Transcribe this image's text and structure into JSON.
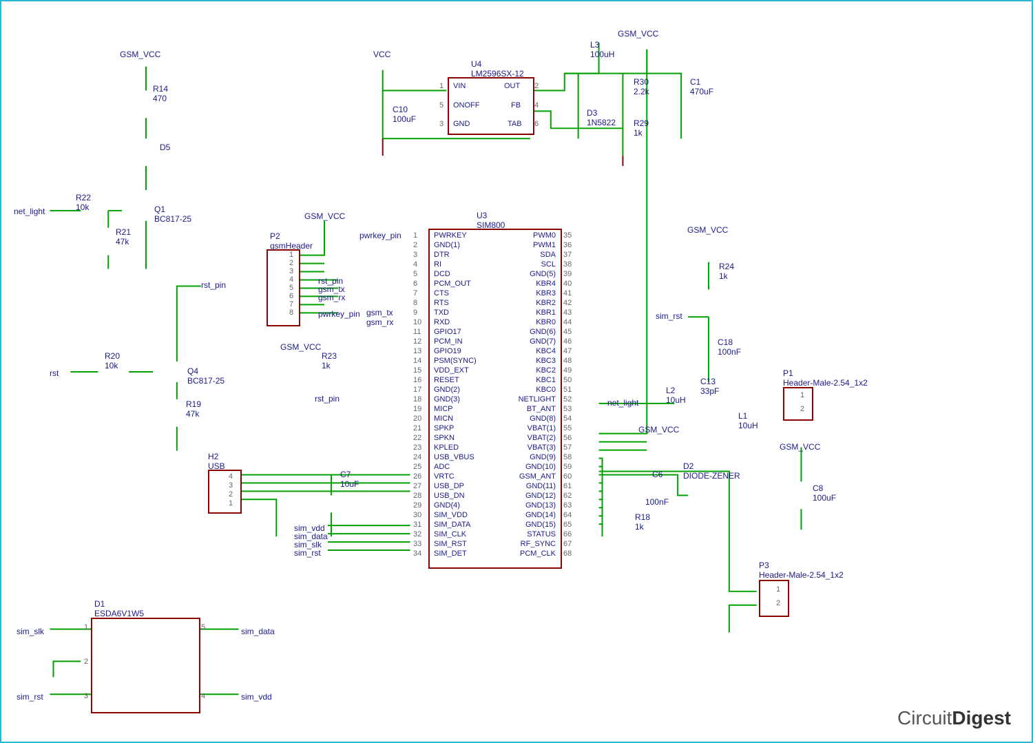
{
  "power_labels": {
    "gsm_vcc": "GSM_VCC",
    "vcc": "VCC"
  },
  "net_labels": {
    "net_light": "net_light",
    "rst_pin": "rst_pin",
    "rst": "rst",
    "pwrkey_pin": "pwrkey_pin",
    "gsm_tx": "gsm_tx",
    "gsm_rx": "gsm_rx",
    "sim_rst": "sim_rst",
    "sim_vdd": "sim_vdd",
    "sim_data": "sim_data",
    "sim_slk": "sim_slk"
  },
  "components": {
    "U3": {
      "ref": "U3",
      "value": "SIM800",
      "left_pins": [
        {
          "num": "1",
          "name": "PWRKEY"
        },
        {
          "num": "2",
          "name": "GND(1)"
        },
        {
          "num": "3",
          "name": "DTR"
        },
        {
          "num": "4",
          "name": "RI"
        },
        {
          "num": "5",
          "name": "DCD"
        },
        {
          "num": "6",
          "name": "PCM_OUT"
        },
        {
          "num": "7",
          "name": "CTS"
        },
        {
          "num": "8",
          "name": "RTS"
        },
        {
          "num": "9",
          "name": "TXD"
        },
        {
          "num": "10",
          "name": "RXD"
        },
        {
          "num": "11",
          "name": "GPIO17"
        },
        {
          "num": "12",
          "name": "PCM_IN"
        },
        {
          "num": "13",
          "name": "GPIO19"
        },
        {
          "num": "14",
          "name": "PSM(SYNC)"
        },
        {
          "num": "15",
          "name": "VDD_EXT"
        },
        {
          "num": "16",
          "name": "RESET"
        },
        {
          "num": "17",
          "name": "GND(2)"
        },
        {
          "num": "18",
          "name": "GND(3)"
        },
        {
          "num": "19",
          "name": "MICP"
        },
        {
          "num": "20",
          "name": "MICN"
        },
        {
          "num": "21",
          "name": "SPKP"
        },
        {
          "num": "22",
          "name": "SPKN"
        },
        {
          "num": "23",
          "name": "KPLED"
        },
        {
          "num": "24",
          "name": "USB_VBUS"
        },
        {
          "num": "25",
          "name": "ADC"
        },
        {
          "num": "26",
          "name": "VRTC"
        },
        {
          "num": "27",
          "name": "USB_DP"
        },
        {
          "num": "28",
          "name": "USB_DN"
        },
        {
          "num": "29",
          "name": "GND(4)"
        },
        {
          "num": "30",
          "name": "SIM_VDD"
        },
        {
          "num": "31",
          "name": "SIM_DATA"
        },
        {
          "num": "32",
          "name": "SIM_CLK"
        },
        {
          "num": "33",
          "name": "SIM_RST"
        },
        {
          "num": "34",
          "name": "SIM_DET"
        }
      ],
      "right_pins": [
        {
          "num": "35",
          "name": "PWM0"
        },
        {
          "num": "36",
          "name": "PWM1"
        },
        {
          "num": "37",
          "name": "SDA"
        },
        {
          "num": "38",
          "name": "SCL"
        },
        {
          "num": "39",
          "name": "GND(5)"
        },
        {
          "num": "40",
          "name": "KBR4"
        },
        {
          "num": "41",
          "name": "KBR3"
        },
        {
          "num": "42",
          "name": "KBR2"
        },
        {
          "num": "43",
          "name": "KBR1"
        },
        {
          "num": "44",
          "name": "KBR0"
        },
        {
          "num": "45",
          "name": "GND(6)"
        },
        {
          "num": "46",
          "name": "GND(7)"
        },
        {
          "num": "47",
          "name": "KBC4"
        },
        {
          "num": "48",
          "name": "KBC3"
        },
        {
          "num": "49",
          "name": "KBC2"
        },
        {
          "num": "50",
          "name": "KBC1"
        },
        {
          "num": "51",
          "name": "KBC0"
        },
        {
          "num": "52",
          "name": "NETLIGHT"
        },
        {
          "num": "53",
          "name": "BT_ANT"
        },
        {
          "num": "54",
          "name": "GND(8)"
        },
        {
          "num": "55",
          "name": "VBAT(1)"
        },
        {
          "num": "56",
          "name": "VBAT(2)"
        },
        {
          "num": "57",
          "name": "VBAT(3)"
        },
        {
          "num": "58",
          "name": "GND(9)"
        },
        {
          "num": "59",
          "name": "GND(10)"
        },
        {
          "num": "60",
          "name": "GSM_ANT"
        },
        {
          "num": "61",
          "name": "GND(11)"
        },
        {
          "num": "62",
          "name": "GND(12)"
        },
        {
          "num": "63",
          "name": "GND(13)"
        },
        {
          "num": "64",
          "name": "GND(14)"
        },
        {
          "num": "65",
          "name": "GND(15)"
        },
        {
          "num": "66",
          "name": "STATUS"
        },
        {
          "num": "67",
          "name": "RF_SYNC"
        },
        {
          "num": "68",
          "name": "PCM_CLK"
        }
      ]
    },
    "U4": {
      "ref": "U4",
      "value": "LM2596SX-12",
      "pins": [
        {
          "num": "1",
          "name": "VIN"
        },
        {
          "num": "2",
          "name": "OUT"
        },
        {
          "num": "5",
          "name": "ONOFF"
        },
        {
          "num": "4",
          "name": "FB"
        },
        {
          "num": "3",
          "name": "GND"
        },
        {
          "num": "6",
          "name": "TAB"
        }
      ]
    },
    "P1": {
      "ref": "P1",
      "value": "Header-Male-2.54_1x2",
      "pins": [
        "1",
        "2"
      ]
    },
    "P2": {
      "ref": "P2",
      "value": "gsmHeader",
      "pins": [
        "1",
        "2",
        "3",
        "4",
        "5",
        "6",
        "7",
        "8"
      ]
    },
    "P3": {
      "ref": "P3",
      "value": "Header-Male-2.54_1x2",
      "pins": [
        "1",
        "2"
      ]
    },
    "H2": {
      "ref": "H2",
      "value": "USB",
      "pins": [
        "4",
        "3",
        "2",
        "1"
      ]
    },
    "D1": {
      "ref": "D1",
      "value": "ESDA6V1W5",
      "pins": [
        "1",
        "2",
        "3",
        "4",
        "5"
      ]
    },
    "D2": {
      "ref": "D2",
      "value": "DIODE-ZENER"
    },
    "D3": {
      "ref": "D3",
      "value": "1N5822"
    },
    "D5": {
      "ref": "D5",
      "value": ""
    },
    "Q1": {
      "ref": "Q1",
      "value": "BC817-25"
    },
    "Q4": {
      "ref": "Q4",
      "value": "BC817-25"
    },
    "R14": {
      "ref": "R14",
      "value": "470"
    },
    "R18": {
      "ref": "R18",
      "value": "1k"
    },
    "R19": {
      "ref": "R19",
      "value": "47k"
    },
    "R20": {
      "ref": "R20",
      "value": "10k"
    },
    "R21": {
      "ref": "R21",
      "value": "47k"
    },
    "R22": {
      "ref": "R22",
      "value": "10k"
    },
    "R23": {
      "ref": "R23",
      "value": "1k"
    },
    "R24": {
      "ref": "R24",
      "value": "1k"
    },
    "R29": {
      "ref": "R29",
      "value": "1k"
    },
    "R30": {
      "ref": "R30",
      "value": "2.2k"
    },
    "C1": {
      "ref": "C1",
      "value": "470uF"
    },
    "C6": {
      "ref": "C6",
      "value": "100nF"
    },
    "C7": {
      "ref": "C7",
      "value": "10uF"
    },
    "C8": {
      "ref": "C8",
      "value": "100uF"
    },
    "C10": {
      "ref": "C10",
      "value": "100uF"
    },
    "C13": {
      "ref": "C13",
      "value": "33pF"
    },
    "C18": {
      "ref": "C18",
      "value": "100nF"
    },
    "L1": {
      "ref": "L1",
      "value": "10uH"
    },
    "L2": {
      "ref": "L2",
      "value": "10uH"
    },
    "L3": {
      "ref": "L3",
      "value": "100uH"
    }
  },
  "logo": "CircuitDigest"
}
